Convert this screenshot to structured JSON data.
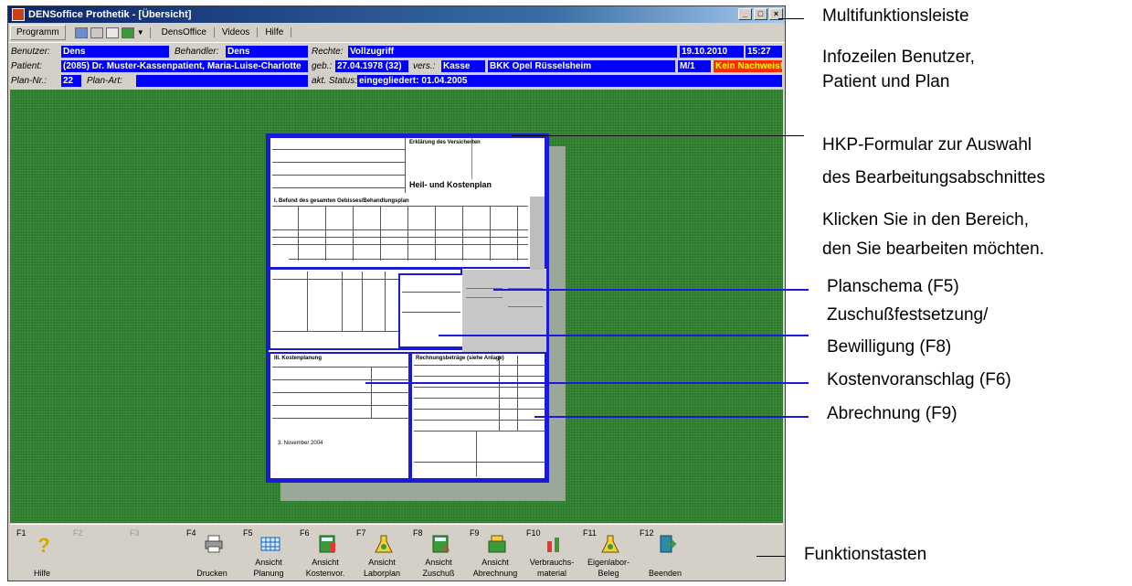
{
  "window": {
    "title": "DENSoffice Prothetik - [Übersicht]"
  },
  "menu": {
    "programm": "Programm",
    "densoffice": "DensOffice",
    "videos": "Videos",
    "hilfe": "Hilfe"
  },
  "info": {
    "benutzer_label": "Benutzer:",
    "benutzer": "Dens",
    "behandler_label": "Behandler:",
    "behandler": "Dens",
    "rechte_label": "Rechte:",
    "rechte": "Vollzugriff",
    "date": "19.10.2010",
    "time": "15:27",
    "patient_label": "Patient:",
    "patient": "(2085) Dr. Muster-Kassenpatient, Maria-Luise-Charlotte",
    "geb_label": "geb.:",
    "geb": "27.04.1978 (32)",
    "vers_label": "vers.:",
    "vers": "Kasse",
    "kasse": "BKK Opel Rüsselsheim",
    "status_code": "M/1",
    "nachweis": "Kein Nachweis!",
    "plan_nr_label": "Plan-Nr.:",
    "plan_nr": "22",
    "plan_art_label": "Plan-Art:",
    "plan_art": "",
    "akt_status_label": "akt. Status:",
    "akt_status": "eingegliedert: 01.04.2005"
  },
  "form": {
    "heading1": "Erklärung des Versicherten",
    "heading2": "Heil- und Kostenplan",
    "befund": "I. Befund des gesamten Gebisses/Behandlungsplan",
    "kosten": "III. Kostenplanung",
    "rechnung": "Rechnungsbeträge (siehe Anlage)",
    "datum": "3. November 2004"
  },
  "fkeys": [
    {
      "key": "F1",
      "label1": "",
      "label2": "Hilfe",
      "enabled": true,
      "icon": "help-icon"
    },
    {
      "key": "F2",
      "label1": "",
      "label2": "",
      "enabled": false,
      "icon": ""
    },
    {
      "key": "F3",
      "label1": "",
      "label2": "",
      "enabled": false,
      "icon": ""
    },
    {
      "key": "F4",
      "label1": "",
      "label2": "Drucken",
      "enabled": true,
      "icon": "printer-icon"
    },
    {
      "key": "F5",
      "label1": "Ansicht",
      "label2": "Planung",
      "enabled": true,
      "icon": "grid-icon"
    },
    {
      "key": "F6",
      "label1": "Ansicht",
      "label2": "Kostenvor.",
      "enabled": true,
      "icon": "calculator-icon"
    },
    {
      "key": "F7",
      "label1": "Ansicht",
      "label2": "Laborplan",
      "enabled": true,
      "icon": "lab-icon"
    },
    {
      "key": "F8",
      "label1": "Ansicht",
      "label2": "Zuschuß",
      "enabled": true,
      "icon": "calculator-percent-icon"
    },
    {
      "key": "F9",
      "label1": "Ansicht",
      "label2": "Abrechnung",
      "enabled": true,
      "icon": "cash-register-icon"
    },
    {
      "key": "F10",
      "label1": "Verbrauchs-",
      "label2": "material",
      "enabled": true,
      "icon": "material-icon"
    },
    {
      "key": "F11",
      "label1": "Eigenlabor-",
      "label2": "Beleg",
      "enabled": true,
      "icon": "lab-icon"
    },
    {
      "key": "F12",
      "label1": "",
      "label2": "Beenden",
      "enabled": true,
      "icon": "exit-door-icon"
    }
  ],
  "annotations": {
    "multifunktion": "Multifunktionsleiste",
    "infozeilen1": "Infozeilen Benutzer,",
    "infozeilen2": "Patient und Plan",
    "hkp1": "HKP-Formular zur Auswahl",
    "hkp2": "des Bearbeitungsabschnittes",
    "klicken1": "Klicken Sie in den Bereich,",
    "klicken2": "den Sie bearbeiten möchten.",
    "planschema": "Planschema (F5)",
    "zuschuss1": "Zuschußfestsetzung/",
    "zuschuss2": "Bewilligung (F8)",
    "kostenvor": "Kostenvoranschlag (F6)",
    "abrechnung": "Abrechnung (F9)",
    "funktion": "Funktionstasten"
  },
  "colors": {
    "accent": "#0000ff",
    "workspace": "#2e7a2e",
    "warning": "#ff2a00"
  }
}
